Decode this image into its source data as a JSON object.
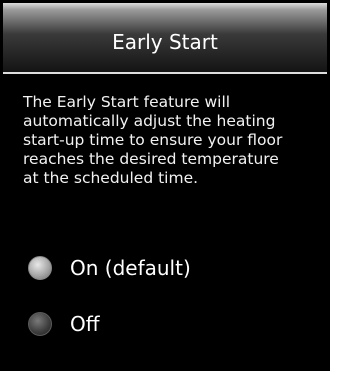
{
  "header": {
    "title": "Early Start"
  },
  "description": "The Early Start feature will\nautomatically adjust the heating\nstart-up time to ensure your floor\nreaches the desired temperature\nat the scheduled time.",
  "options": [
    {
      "label": "On (default)",
      "selected": true,
      "icon": "radio-selected-icon"
    },
    {
      "label": "Off",
      "selected": false,
      "icon": "radio-unselected-icon"
    }
  ],
  "colors": {
    "background": "#000000",
    "text": "#ffffff",
    "divider": "#dddddd"
  }
}
